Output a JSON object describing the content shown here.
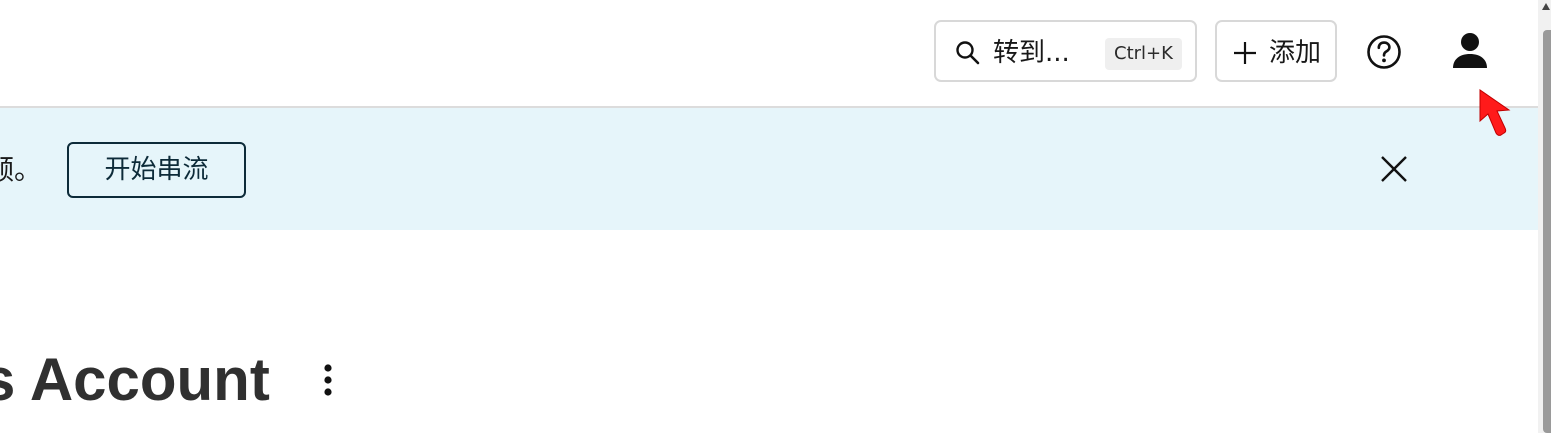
{
  "header": {
    "search": {
      "label": "转到...",
      "shortcut": "Ctrl+K",
      "icon": "search-icon"
    },
    "add": {
      "label": "添加",
      "icon": "plus-icon"
    },
    "help": {
      "icon": "help-icon"
    },
    "user": {
      "icon": "user-icon"
    }
  },
  "banner": {
    "text_fragment": "频。",
    "button_label": "开始串流",
    "close_icon": "close-icon",
    "background": "#e6f5fa",
    "accent": "#0d2b39"
  },
  "page": {
    "title": "s Account",
    "menu_icon": "more-vertical-icon"
  },
  "cursor": {
    "icon": "pointer-cursor",
    "color": "#ff1a1a"
  }
}
